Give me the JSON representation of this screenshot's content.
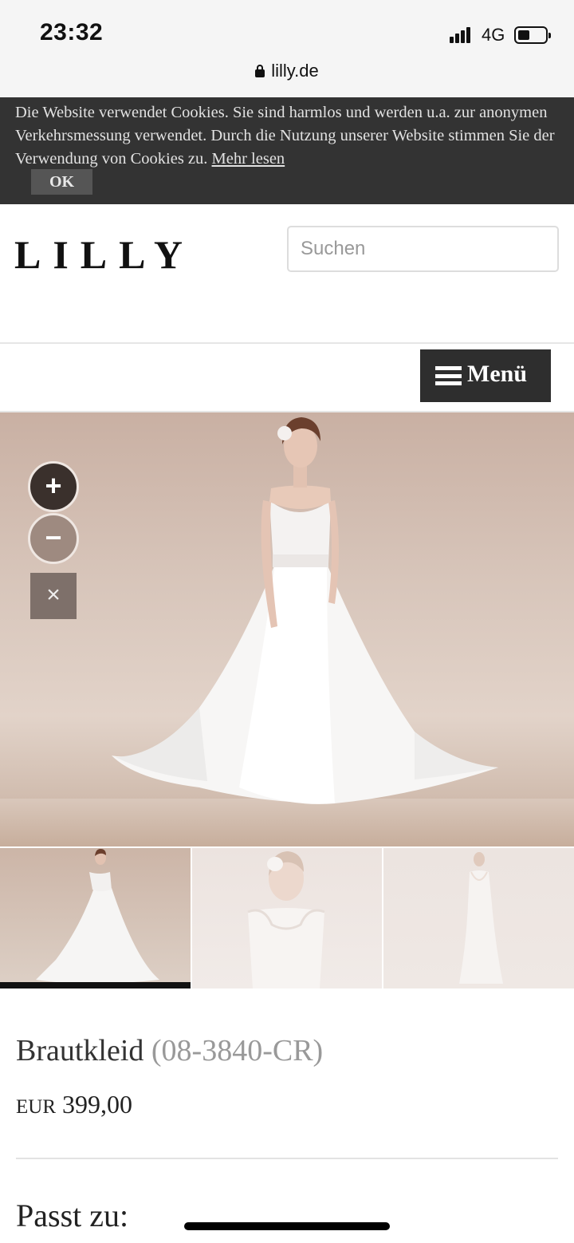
{
  "status_bar": {
    "time": "23:32",
    "network": "4G",
    "url": "lilly.de"
  },
  "cookie_banner": {
    "text": "Die Website verwendet Cookies. Sie sind harmlos und werden u.a. zur anonymen Verkehrsmessung verwendet. Durch die Nutzung unserer Website stimmen Sie der Verwendung von Cookies zu.",
    "link_label": "Mehr lesen",
    "ok_label": "OK"
  },
  "header": {
    "logo": "LILLY",
    "search_placeholder": "Suchen",
    "menu_label": "Menü"
  },
  "gallery": {
    "zoom_in_symbol": "+",
    "zoom_out_symbol": "−",
    "close_symbol": "×",
    "thumbnail_count": 3,
    "active_thumbnail": 1
  },
  "product": {
    "name": "Brautkleid",
    "sku": "(08-3840-CR)",
    "currency": "EUR",
    "price": "399,00"
  },
  "section": {
    "passt_zu": "Passt zu:"
  },
  "colors": {
    "banner_bg": "#333333",
    "menu_bg": "#2e2e2e",
    "sku_color": "#999999"
  }
}
